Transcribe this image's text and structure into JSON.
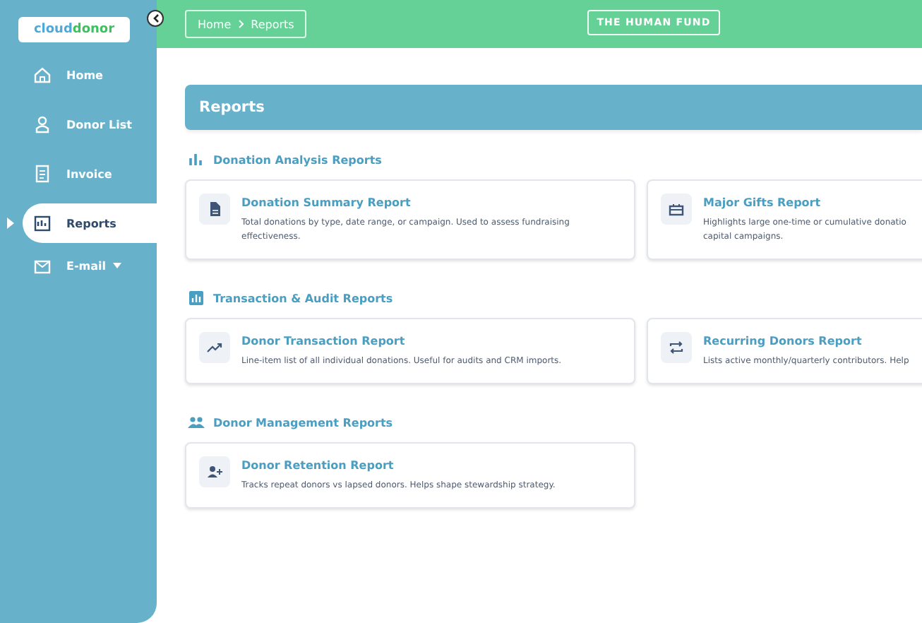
{
  "logo": {
    "first": "cloud",
    "second": "donor"
  },
  "sidebar": {
    "items": [
      {
        "label": "Home",
        "selected": false
      },
      {
        "label": "Donor List",
        "selected": false
      },
      {
        "label": "Invoice",
        "selected": false
      },
      {
        "label": "Reports",
        "selected": true
      },
      {
        "label": "E-mail",
        "selected": false,
        "kind": "dropdown"
      }
    ]
  },
  "breadcrumb": [
    "Home",
    "Reports"
  ],
  "organization": "THE HUMAN FUND",
  "page_title": "Reports",
  "sections": [
    {
      "title": "Donation Analysis Reports",
      "cards": [
        {
          "title": "Donation Summary Report",
          "description": [
            "Total donations by type, date range, or campaign. Used to assess fundraising",
            "effectiveness."
          ]
        },
        {
          "title": "Major Gifts Report",
          "description": [
            "Highlights large one-time or cumulative donatio",
            "capital campaigns."
          ]
        }
      ]
    },
    {
      "title": "Transaction & Audit Reports",
      "cards": [
        {
          "title": "Donor Transaction Report",
          "description": [
            "Line-item list of all individual donations. Useful for audits and CRM imports."
          ]
        },
        {
          "title": "Recurring Donors Report",
          "description": [
            "Lists active monthly/quarterly contributors. Help"
          ]
        }
      ]
    },
    {
      "title": "Donor Management Reports",
      "cards": [
        {
          "title": "Donor Retention Report",
          "description": [
            "Tracks repeat donors vs lapsed donors. Helps shape stewardship strategy."
          ]
        }
      ]
    }
  ]
}
